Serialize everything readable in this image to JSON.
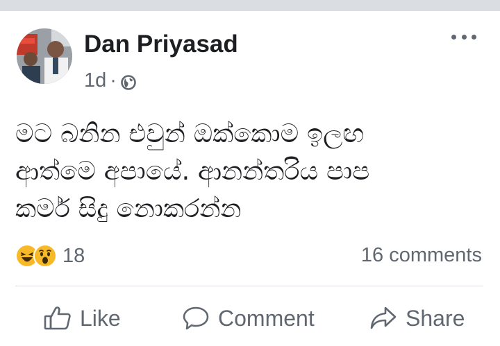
{
  "post": {
    "author": "Dan Priyasad",
    "time": "1d",
    "separator": "·",
    "privacy_icon": "globe-icon",
    "menu_icon": "more-options-icon",
    "text_lines": [
      "මට බනින එවුන් ඔක්කොම ඉලඟ",
      "ආත්මෙ අපායේ. ආනන්තරිය පාප",
      "කර්ම සිදු නොකරන්න"
    ],
    "reactions": {
      "icons": [
        "haha-reaction-icon",
        "wow-reaction-icon"
      ],
      "count": "18",
      "color": "#f7b928"
    },
    "comments": "16 comments"
  },
  "actions": {
    "like": "Like",
    "comment": "Comment",
    "share": "Share"
  },
  "colors": {
    "text": "#1c1e21",
    "secondary": "#606770",
    "divider": "#dadde1"
  }
}
